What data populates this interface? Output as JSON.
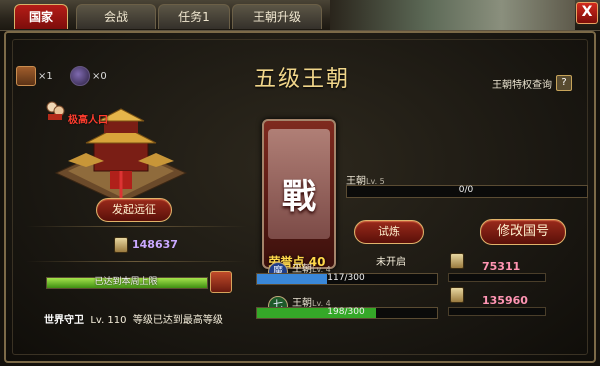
{
  "tabs": [
    {
      "label": "国家",
      "active": true
    },
    {
      "label": "会战",
      "active": false
    },
    {
      "label": "任务1",
      "active": false
    },
    {
      "label": "王朝升级",
      "active": false
    }
  ],
  "close_label": "X",
  "title": "五级王朝",
  "items": [
    {
      "icon": "tomb-icon",
      "count": "×1"
    },
    {
      "icon": "bag-icon",
      "count": "×0"
    }
  ],
  "privilege": {
    "label": "王朝特权查询",
    "help": "?"
  },
  "palace": {
    "pop_label": "极高人口",
    "expedition_button": "发起远征"
  },
  "left_value": "148637",
  "limit": {
    "text": "已达到本周上限",
    "fill_pct": 100
  },
  "guard": {
    "name": "世界守卫",
    "level_label": "Lv. 110",
    "desc": "等级已达到最高等级"
  },
  "banner": {
    "char": "戰",
    "honor": "荣誉点 40"
  },
  "dynasty": {
    "label": "王朝",
    "level": "Lv. 5",
    "progress_text": "0/0",
    "fill_pct": 0
  },
  "buttons": {
    "trial": "试炼",
    "rename": "修改国号"
  },
  "not_open": "未开启",
  "factions": [
    {
      "icon_char": "魔",
      "label": "王朝",
      "level": "Lv. 4",
      "progress": "117/300",
      "fill_pct": 39,
      "value": "75311",
      "color": "#3a87d8"
    },
    {
      "icon_char": "七",
      "label": "王朝",
      "level": "Lv. 4",
      "progress": "198/300",
      "fill_pct": 66,
      "value": "135960",
      "color": "#35a828"
    }
  ],
  "colors": {
    "accent_red": "#b51d17",
    "gold": "#f1d68a",
    "purple_value": "#c9a8ff",
    "pink_value": "#ff95b3"
  }
}
